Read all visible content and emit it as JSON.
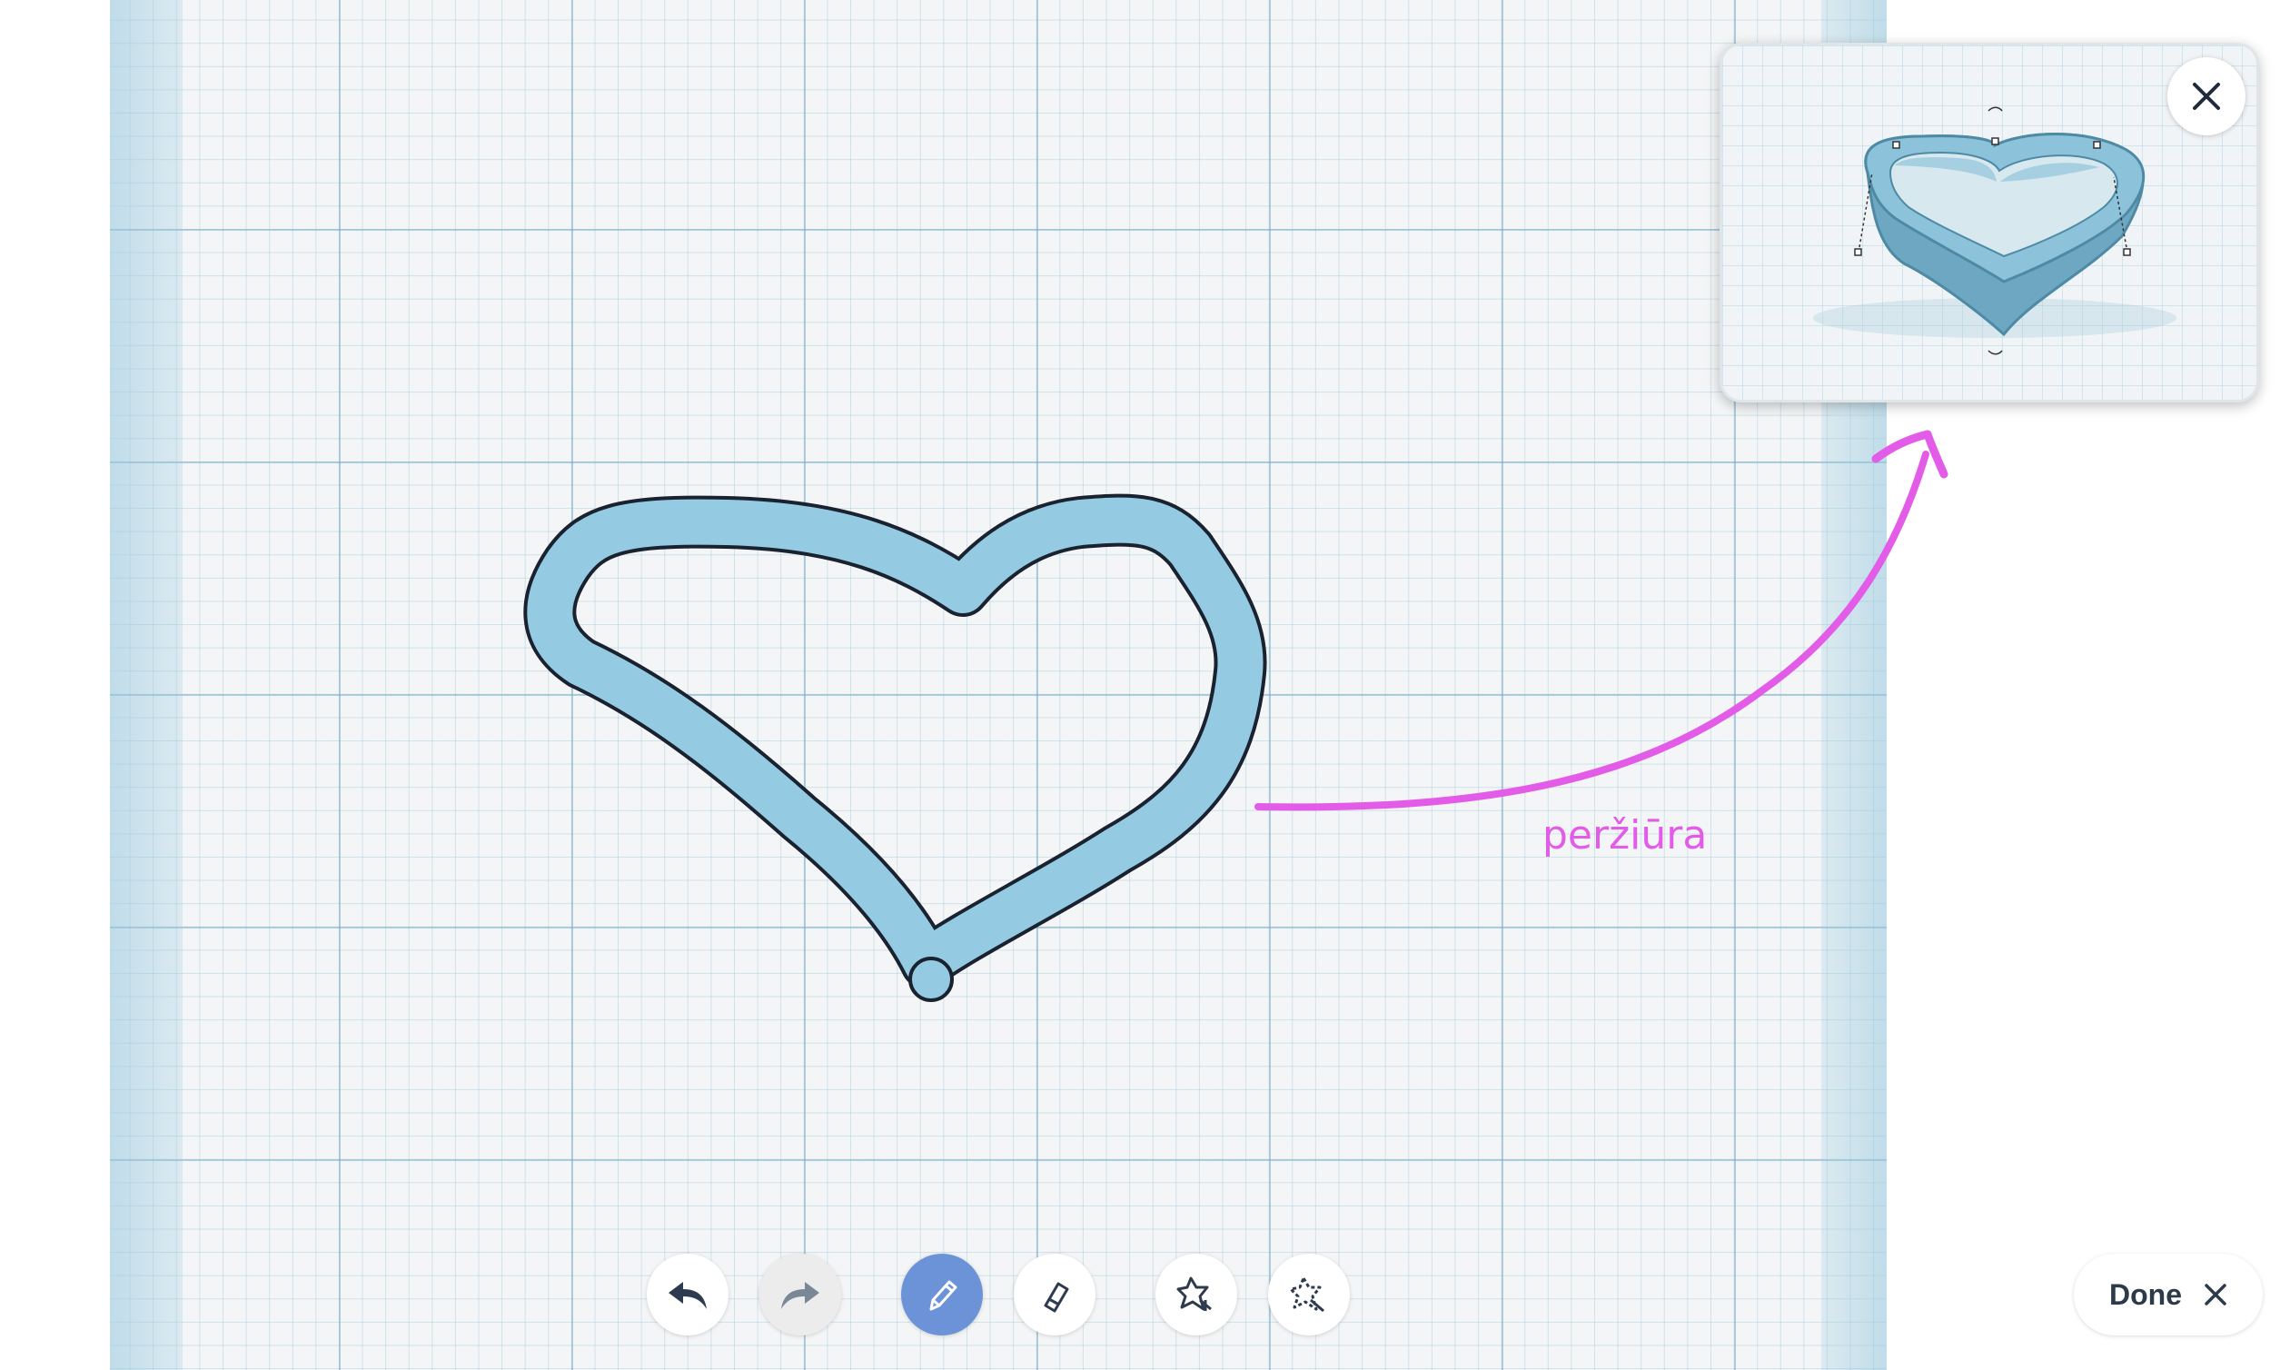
{
  "annotation": {
    "label": "peržiūra"
  },
  "toolbar": {
    "undo": "undo-icon",
    "redo": "redo-icon",
    "pencil": "pencil-icon",
    "eraser": "eraser-icon",
    "add_shape": "shape-add-icon",
    "remove_shape": "shape-remove-icon"
  },
  "done": {
    "label": "Done"
  },
  "colors": {
    "shape_fill": "#94cbe3",
    "shape_stroke": "#1a2230",
    "annotation": "#e35ce8",
    "active_tool": "#6c93d8"
  }
}
